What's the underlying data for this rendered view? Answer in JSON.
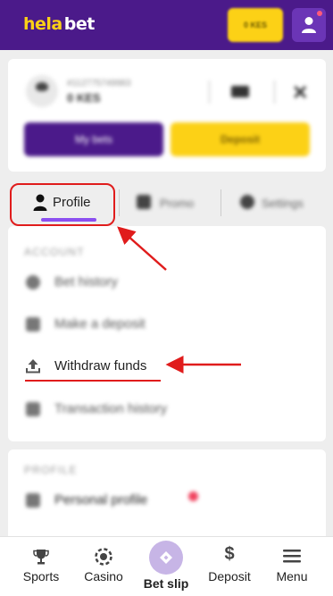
{
  "header": {
    "logo_part1": "hela",
    "logo_part2": "bet",
    "balance": "0 KES",
    "user_icon": "user-icon"
  },
  "account": {
    "user_id": "#112775749983",
    "balance": "0 KES",
    "my_bets_label": "My bets",
    "deposit_label": "Deposit"
  },
  "tabs": {
    "profile": "Profile",
    "promo": "Promo",
    "settings": "Settings"
  },
  "account_menu": {
    "title": "ACCOUNT",
    "items": [
      {
        "label": "Bet history",
        "icon": "history-icon"
      },
      {
        "label": "Make a deposit",
        "icon": "deposit-icon"
      },
      {
        "label": "Withdraw funds",
        "icon": "withdraw-icon"
      },
      {
        "label": "Transaction history",
        "icon": "transactions-icon"
      }
    ]
  },
  "profile_menu": {
    "title": "PROFILE",
    "items": [
      {
        "label": "Personal profile",
        "icon": "person-icon"
      }
    ]
  },
  "bottom_nav": [
    {
      "label": "Sports",
      "icon": "trophy-icon"
    },
    {
      "label": "Casino",
      "icon": "chip-icon"
    },
    {
      "label": "Bet slip",
      "icon": "ticket-icon"
    },
    {
      "label": "Deposit",
      "icon": "dollar-icon"
    },
    {
      "label": "Menu",
      "icon": "hamburger-icon"
    }
  ],
  "colors": {
    "brand_purple": "#4b1a8a",
    "brand_yellow": "#fcd116",
    "annotation_red": "#e01c1c",
    "tab_underline": "#8b4ff0"
  }
}
